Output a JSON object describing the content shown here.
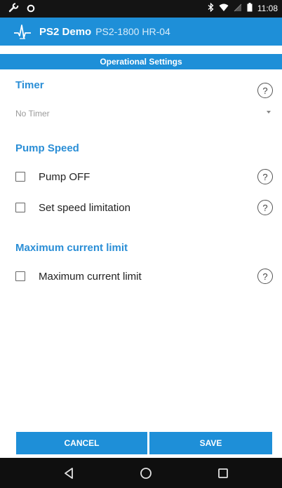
{
  "status_bar": {
    "time": "11:08",
    "left_icons": [
      "wrench-icon",
      "circle-icon"
    ],
    "right_icons": [
      "bluetooth-icon",
      "wifi-icon",
      "signal-icon",
      "battery-icon"
    ]
  },
  "app_bar": {
    "title": "PS2 Demo",
    "subtitle": "PS2-1800 HR-04",
    "logo_icon": "heartbeat-icon"
  },
  "sub_header": {
    "title": "Operational Settings"
  },
  "timer": {
    "title": "Timer",
    "selected": "No Timer"
  },
  "pump_speed": {
    "title": "Pump Speed",
    "items": [
      {
        "label": "Pump OFF",
        "checked": false
      },
      {
        "label": "Set speed limitation",
        "checked": false
      }
    ]
  },
  "max_current": {
    "title": "Maximum current limit",
    "items": [
      {
        "label": "Maximum current limit",
        "checked": false
      }
    ]
  },
  "help_symbol": "?",
  "buttons": {
    "cancel": "CANCEL",
    "save": "SAVE"
  },
  "nav_bar": {
    "icons": [
      "back-icon",
      "home-icon",
      "recents-icon"
    ]
  },
  "colors": {
    "accent": "#1e8fd8",
    "section_title": "#2a8ed6",
    "status_bar": "#141414",
    "nav_bar": "#0f0f0f"
  }
}
